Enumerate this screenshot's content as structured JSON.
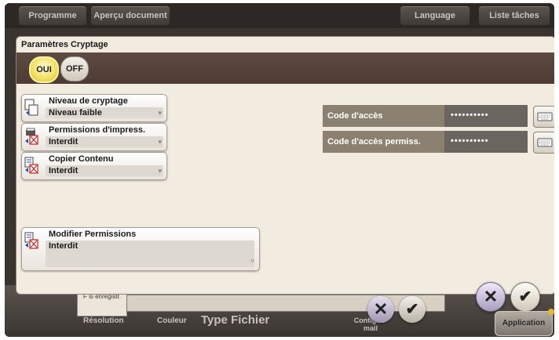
{
  "topbar": {
    "programme": "Programme",
    "apercu": "Aperçu document",
    "language": "Language",
    "liste_taches": "Liste tâches"
  },
  "dialog": {
    "title": "Paramètres Cryptage",
    "toggle_on": "OUI",
    "toggle_off": "OFF",
    "selected_toggle": "OUI",
    "settings": [
      {
        "label": "Niveau de cryptage",
        "value": "Niveau faible"
      },
      {
        "label": "Permissions d'impress.",
        "value": "Interdit"
      },
      {
        "label": "Copier Contenu",
        "value": "Interdit"
      },
      {
        "label": "Modifier Permissions",
        "value": "Interdit"
      }
    ],
    "fields": [
      {
        "label": "Code d'accès",
        "value": "••••••••••"
      },
      {
        "label": "Code d'accès permiss.",
        "value": "••••••••••"
      }
    ],
    "arrow_glyph": "»"
  },
  "background": {
    "resolution_box": "F si enregistr.",
    "resolution": "Résolution",
    "couleur": "Couleur",
    "type_fichier": "Type Fichier",
    "config_email": "Config. E-mail"
  },
  "actions": {
    "cancel_glyph": "✕",
    "ok_glyph": "✔"
  },
  "application": "Application",
  "colors": {
    "accent_on": "#f2e060",
    "label_bar": "#8c8170",
    "dark_frame": "#3a3430"
  }
}
